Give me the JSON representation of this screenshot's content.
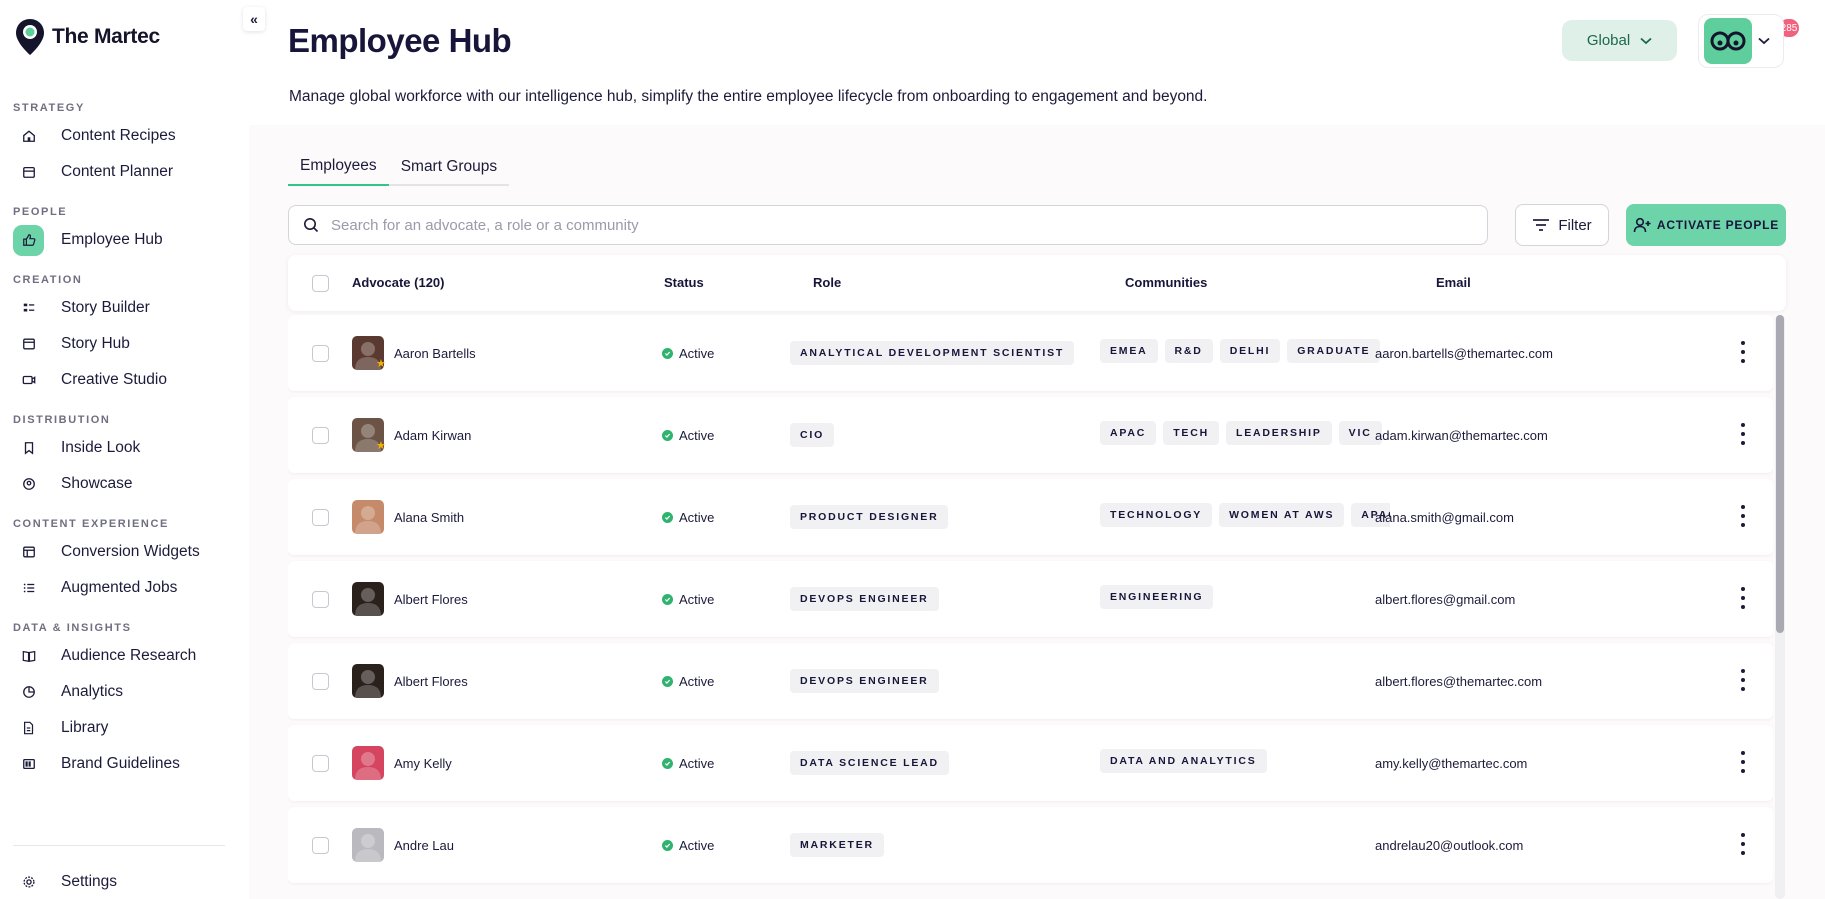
{
  "brand": {
    "name": "The Martec",
    "accent": "#6dd3a8"
  },
  "sidebar": {
    "sections": [
      {
        "label": "STRATEGY",
        "items": [
          {
            "label": "Content Recipes",
            "icon": "home-icon"
          },
          {
            "label": "Content Planner",
            "icon": "calendar-icon"
          }
        ]
      },
      {
        "label": "PEOPLE",
        "items": [
          {
            "label": "Employee Hub",
            "icon": "thumbs-up-icon",
            "active": true
          }
        ]
      },
      {
        "label": "CREATION",
        "items": [
          {
            "label": "Story Builder",
            "icon": "layout-list-icon"
          },
          {
            "label": "Story Hub",
            "icon": "window-icon"
          },
          {
            "label": "Creative Studio",
            "icon": "video-icon"
          }
        ]
      },
      {
        "label": "DISTRIBUTION",
        "items": [
          {
            "label": "Inside Look",
            "icon": "bookmark-icon"
          },
          {
            "label": "Showcase",
            "icon": "user-circle-icon"
          }
        ]
      },
      {
        "label": "CONTENT EXPERIENCE",
        "items": [
          {
            "label": "Conversion Widgets",
            "icon": "widget-icon"
          },
          {
            "label": "Augmented Jobs",
            "icon": "list-icon"
          }
        ]
      },
      {
        "label": "DATA & INSIGHTS",
        "items": [
          {
            "label": "Audience Research",
            "icon": "book-open-icon"
          },
          {
            "label": "Analytics",
            "icon": "pie-chart-icon"
          },
          {
            "label": "Library",
            "icon": "files-icon"
          },
          {
            "label": "Brand Guidelines",
            "icon": "palette-icon"
          }
        ]
      }
    ],
    "settings": {
      "label": "Settings",
      "icon": "gear-icon"
    }
  },
  "header": {
    "title": "Employee Hub",
    "description": "Manage global workforce with our intelligence hub, simplify the entire employee lifecycle from onboarding to engagement and beyond.",
    "notification_count": "285",
    "region": "Global"
  },
  "tabs": [
    {
      "label": "Employees",
      "active": true
    },
    {
      "label": "Smart Groups",
      "active": false
    }
  ],
  "search": {
    "placeholder": "Search for an advocate, a role or a community",
    "value": ""
  },
  "toolbar": {
    "filter_label": "Filter",
    "activate_label": "ACTIVATE PEOPLE"
  },
  "table": {
    "columns": {
      "advocate": "Advocate (120)",
      "status": "Status",
      "role": "Role",
      "communities": "Communities",
      "email": "Email"
    },
    "rows": [
      {
        "name": "Aaron Bartells",
        "status": "Active",
        "role": "ANALYTICAL DEVELOPMENT SCIENTIST",
        "communities": [
          "EMEA",
          "R&D",
          "DELHI",
          "GRADUATE"
        ],
        "email": "aaron.bartells@themartec.com",
        "starred": true,
        "avatar_color": "#5a3a30"
      },
      {
        "name": "Adam Kirwan",
        "status": "Active",
        "role": "CIO",
        "communities": [
          "APAC",
          "TECH",
          "LEADERSHIP",
          "VIC"
        ],
        "email": "adam.kirwan@themartec.com",
        "starred": true,
        "avatar_color": "#6b5446"
      },
      {
        "name": "Alana Smith",
        "status": "Active",
        "role": "PRODUCT DESIGNER",
        "communities": [
          "TECHNOLOGY",
          "WOMEN AT AWS",
          "APAC"
        ],
        "email": "alana.smith@gmail.com",
        "starred": false,
        "avatar_color": "#c58a6a"
      },
      {
        "name": "Albert Flores",
        "status": "Active",
        "role": "DEVOPS ENGINEER",
        "communities": [
          "ENGINEERING"
        ],
        "email": "albert.flores@gmail.com",
        "starred": false,
        "avatar_color": "#2a211d"
      },
      {
        "name": "Albert Flores",
        "status": "Active",
        "role": "DEVOPS ENGINEER",
        "communities": [],
        "email": "albert.flores@themartec.com",
        "starred": false,
        "avatar_color": "#2a211d"
      },
      {
        "name": "Amy Kelly",
        "status": "Active",
        "role": "DATA SCIENCE LEAD",
        "communities": [
          "DATA AND ANALYTICS"
        ],
        "email": "amy.kelly@themartec.com",
        "starred": false,
        "avatar_color": "#d5455f"
      },
      {
        "name": "Andre Lau",
        "status": "Active",
        "role": "MARKETER",
        "communities": [],
        "email": "andrelau20@outlook.com",
        "starred": false,
        "avatar_color": "#b9b9bf"
      }
    ]
  }
}
